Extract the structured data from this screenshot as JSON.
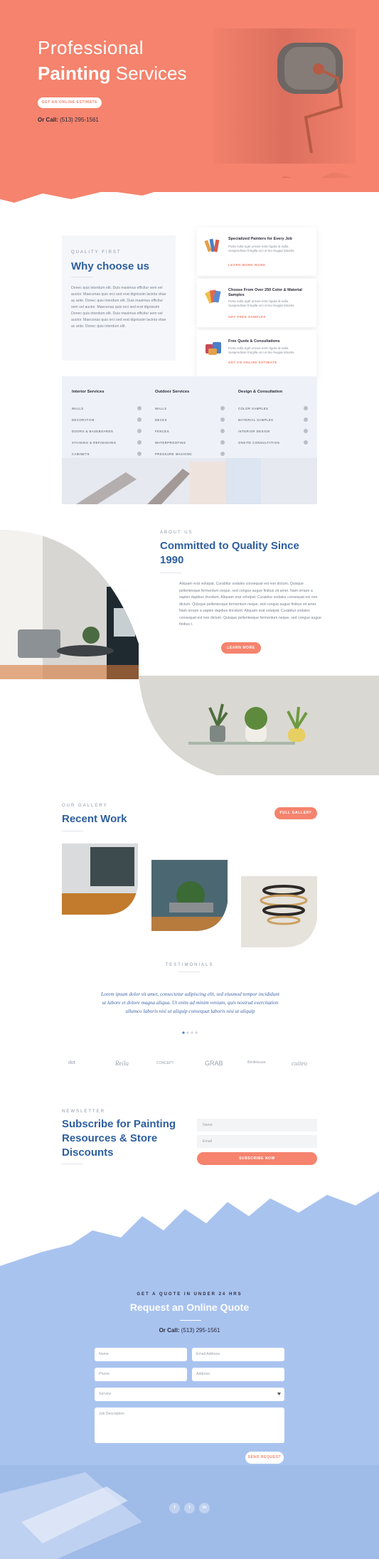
{
  "colors": {
    "accent": "#f5836d",
    "heading": "#2e5f9e",
    "quote_bg": "#a9c3ef"
  },
  "hero": {
    "title_light": "Professional",
    "title_bold": "Painting",
    "title_rest": "Services",
    "cta_label": "GET AN ONLINE ESTIMATE",
    "call_label": "Or Call:",
    "call_number": "(513) 295-1561"
  },
  "why": {
    "eyebrow": "QUALITY FIRST",
    "title": "Why choose us",
    "text": "Donec quis interdum elit. Duis maximus efficitur sem vel auctor. Maecenas quis orci sed erat dignissim lacinia vitae ac ante. Donec quis interdum elit. Duis maximus efficitur sem vel auctor. Maecenas quis orci sed erat dignissim Donec quis interdum elit. Duis maximus efficitur sem vel auctor. Maecenas quis orci sed erat dignissim lacinia vitae ac ante. Donec quis interdum elit.",
    "features": [
      {
        "title": "Specialized Painters for Every Job",
        "desc": "Porta nulla eget ornare enim ligula id nulla. Suspendisse fringilla orci et leo feugiat lobortis.",
        "link": "LEARN MORE WORK",
        "icon": "brushes-icon"
      },
      {
        "title": "Choose From Over 250 Color & Material Samples",
        "desc": "Porta nulla eget ornare enim ligula id nulla. Suspendisse fringilla orci et leo feugiat lobortis.",
        "link": "GET FREE SAMPLES",
        "icon": "color-swatches-icon"
      },
      {
        "title": "Free Quote & Consultations",
        "desc": "Porta nulla eget ornare enim ligula id nulla. Suspendisse fringilla orci et leo feugiat lobortis.",
        "link": "GET AN ONLINE ESTIMATE",
        "icon": "paint-cans-icon"
      }
    ]
  },
  "services": {
    "columns": [
      {
        "heading": "Interior Services",
        "items": [
          "WALLS",
          "DECORATIVE",
          "DOORS & BASEBOARDS",
          "STAINING & REFINISHING",
          "CABINETS"
        ]
      },
      {
        "heading": "Outdoor Services",
        "items": [
          "WALLS",
          "DECKS",
          "FENCES",
          "WATERPROOFING",
          "PRESSURE WASHING"
        ]
      },
      {
        "heading": "Design & Consultation",
        "items": [
          "COLOR SAMPLES",
          "MATERIAL SAMPLES",
          "INTERIOR DESIGN",
          "ONSITE CONSULTATION"
        ]
      }
    ]
  },
  "about": {
    "eyebrow": "ABOUT US",
    "title": "Committed to Quality Since 1990",
    "text": "Aliquam erat volutpat. Curabitur sodales consequat est non dictum. Quisque pellentesque fermentum neque, sed congue augue finibus sit amet. Nam ornare a sapien dapibus tincidunt. Aliquam erat volutpat. Curabitur sodales consequat est non dictum. Quisque pellentesque fermentum neque, sed congue augue finibus sit amet. Nam ornare a sapien dapibus tincidunt. Aliquam erat volutpat. Curabitur sodales consequat est non dictum. Quisque pellentesque fermentum neque, sed congue augue finibus t.",
    "cta_label": "LEARN MORE"
  },
  "recent": {
    "eyebrow": "OUR GALLERY",
    "title": "Recent Work",
    "cta_label": "FULL GALLERY"
  },
  "testimonials": {
    "eyebrow": "TESTIMONIALS",
    "quote": "Lorem ipsum dolor sit amet, consectetur adipiscing elit, sed eiusmod tempor incididunt ut labore et dolore magna aliqua. Ut enim ad minim veniam, quis nostrud exercitation ullamco laboris nisi ut aliquip consequat laboris nisi ut aliquip",
    "logos": [
      "dot",
      "Reila",
      "CONCEPT",
      "GRAB",
      "BirdHouse",
      "cuiteo"
    ]
  },
  "newsletter": {
    "eyebrow": "NEWSLETTER",
    "title": "Subscribe for Painting Resources & Store Discounts",
    "name_placeholder": "Name",
    "email_placeholder": "Email",
    "cta_label": "SUBSCRIBE NOW"
  },
  "quote": {
    "eyebrow": "GET A QUOTE IN UNDER 24 HRS",
    "title": "Request an Online Quote",
    "call_label": "Or Call:",
    "call_number": "(513) 295-1561",
    "fields": {
      "name": "Name",
      "email": "Email Address",
      "phone": "Phone",
      "address": "Address",
      "service": "Service",
      "description": "Job Description"
    },
    "cta_label": "SEND REQUEST",
    "social": [
      "f",
      "t",
      "in"
    ]
  }
}
